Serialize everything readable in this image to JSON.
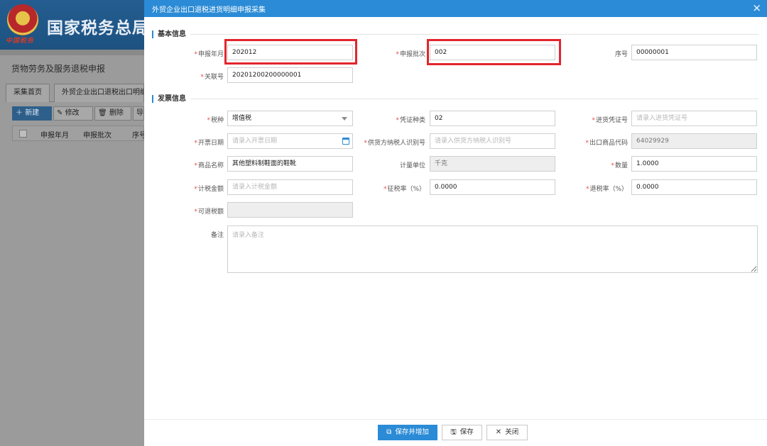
{
  "background": {
    "site_title": "国家税务总局",
    "slogan": "中国税务",
    "module_title": "货物劳务及服务退税申报",
    "tabs": [
      "采集首页",
      "外贸企业出口退税出口明细"
    ],
    "toolbar": {
      "new": "新建",
      "edit": "修改",
      "delete": "删除",
      "more": "导"
    },
    "table_headers": [
      "申报年月",
      "申报批次",
      "序号"
    ]
  },
  "modal": {
    "title": "外贸企业出口退税进货明细申报采集",
    "sections": {
      "basic": "基本信息",
      "invoice": "发票信息"
    },
    "fields": {
      "declare_month": {
        "label": "申报年月",
        "value": "202012"
      },
      "declare_batch": {
        "label": "申报批次",
        "value": "002"
      },
      "serial_no": {
        "label": "序号",
        "value": "00000001"
      },
      "link_no": {
        "label": "关联号",
        "value": "20201200200000001"
      },
      "tax_type": {
        "label": "税种",
        "value": "增值税"
      },
      "voucher_type": {
        "label": "凭证种类",
        "value": "02"
      },
      "voucher_no": {
        "label": "进货凭证号",
        "placeholder": "请录入进货凭证号"
      },
      "invoice_date": {
        "label": "开票日期",
        "placeholder": "请录入开票日期"
      },
      "supplier_tax_id": {
        "label": "供货方纳税人识别号",
        "placeholder": "请录入供货方纳税人识别号"
      },
      "export_code": {
        "label": "出口商品代码",
        "value": "64029929"
      },
      "goods_name": {
        "label": "商品名称",
        "value": "其他塑料制鞋面的鞋靴"
      },
      "unit": {
        "label": "计量单位",
        "value": "千克"
      },
      "quantity": {
        "label": "数量",
        "value": "1.0000"
      },
      "tax_amount": {
        "label": "计税金额",
        "placeholder": "请录入计税金额"
      },
      "levy_rate": {
        "label": "征税率（%）",
        "value": "0.0000"
      },
      "refund_rate": {
        "label": "退税率（%）",
        "value": "0.0000"
      },
      "refundable": {
        "label": "可退税额",
        "value": ""
      },
      "remark": {
        "label": "备注",
        "placeholder": "请录入备注"
      }
    },
    "buttons": {
      "save_add": "保存并增加",
      "save": "保存",
      "close": "关闭"
    }
  },
  "colors": {
    "accent": "#2b8bd6",
    "required": "#e24b4b",
    "highlight": "#e3252d"
  }
}
